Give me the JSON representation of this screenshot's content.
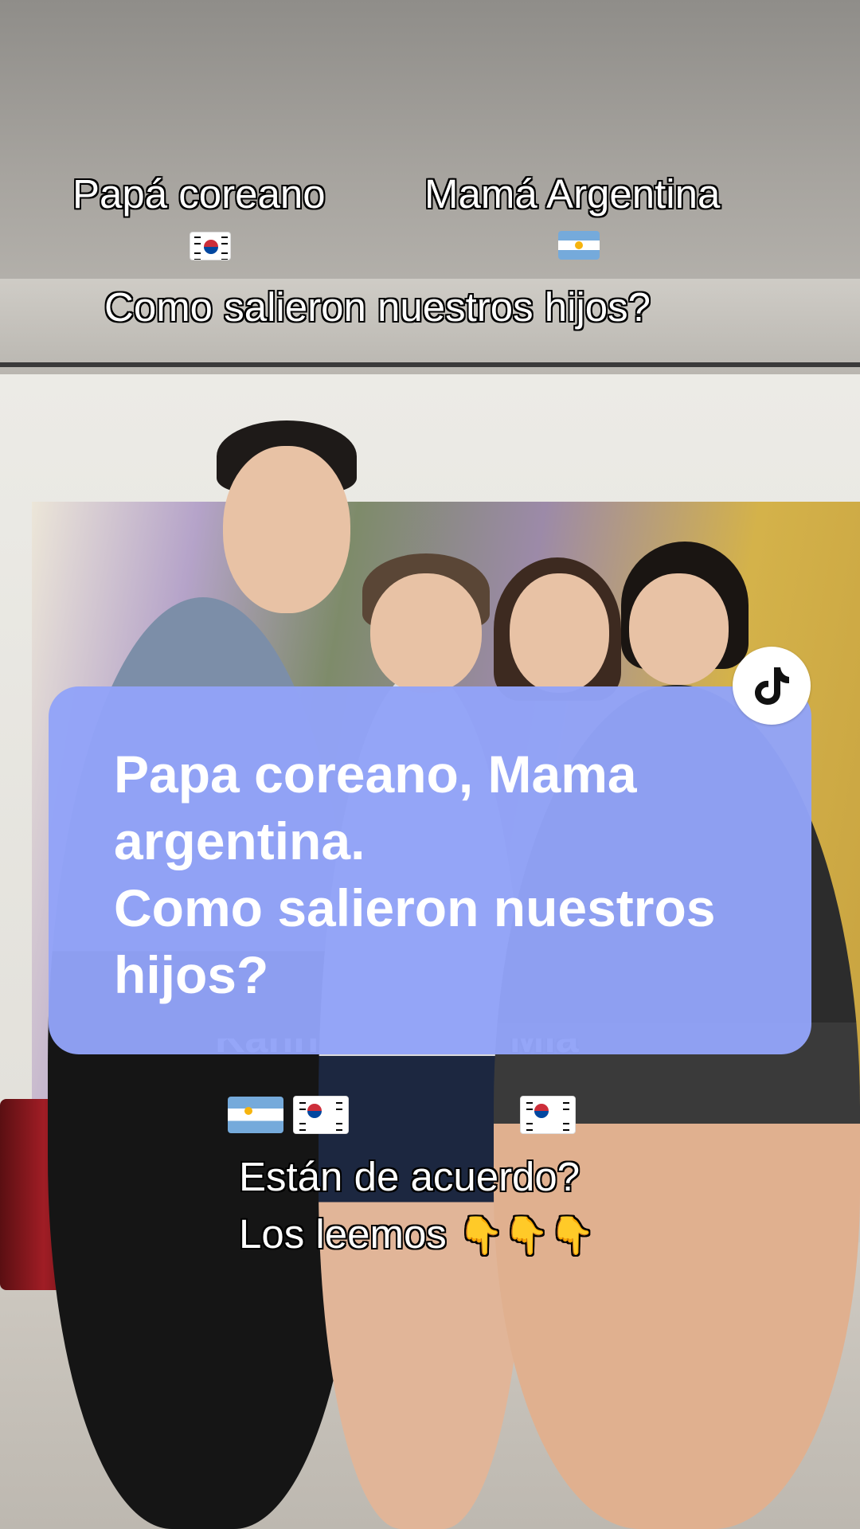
{
  "captions": {
    "dad_label": "Papá coreano",
    "mom_label": "Mamá Argentina",
    "question": "Como salieron nuestros hijos?",
    "agree": "Están de acuerdo?",
    "read_prompt": "Los leemos",
    "pointing_emojis": "👇👇👇"
  },
  "children_names": {
    "first_visible": "Kann",
    "second_visible": "Mia"
  },
  "card": {
    "line1": "Papa coreano, Mama",
    "line2": "argentina.",
    "line3": "Como salieron nuestros",
    "line4": "hijos?"
  },
  "icons": {
    "tiktok": "tiktok-logo-icon",
    "flags": [
      "south-korea-flag-icon",
      "argentina-flag-icon"
    ]
  },
  "colors": {
    "card_bg": "#92a3f8",
    "caption_text": "#ffffff",
    "caption_outline": "#000000"
  }
}
